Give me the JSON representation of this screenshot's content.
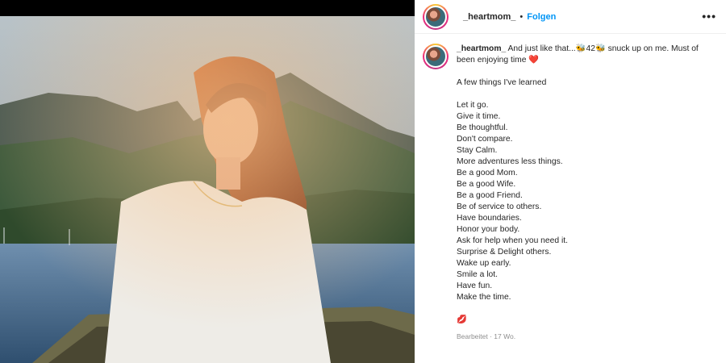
{
  "header": {
    "username": "_heartmom_",
    "separator": "•",
    "follow_label": "Folgen",
    "more_label": "•••"
  },
  "caption": {
    "username": "_heartmom_",
    "intro": "And just like that...🐝42🐝 snuck up on me. Must of been enjoying time",
    "intro_emoji": "❤️",
    "heading": "A few things I've learned",
    "lessons": [
      "Let it go.",
      "Give it time.",
      "Be thoughtful.",
      "Don't compare.",
      "Stay Calm.",
      "More adventures less things.",
      "Be a good Mom.",
      "Be a good Wife.",
      "Be a good Friend.",
      "Be of service to others.",
      "Have boundaries.",
      "Honor your body.",
      "Ask for help when you need it.",
      "Surprise & Delight others.",
      "Wake up early.",
      "Smile a lot.",
      "Have fun.",
      "Make the time."
    ],
    "closing_emoji": "💋",
    "meta": "Bearbeitet · 17 Wo."
  },
  "colors": {
    "accent": "#0095f6",
    "text": "#262626",
    "muted": "#8e8e8e"
  },
  "icons": {
    "more": "more-options-icon",
    "avatar": "profile-avatar"
  }
}
